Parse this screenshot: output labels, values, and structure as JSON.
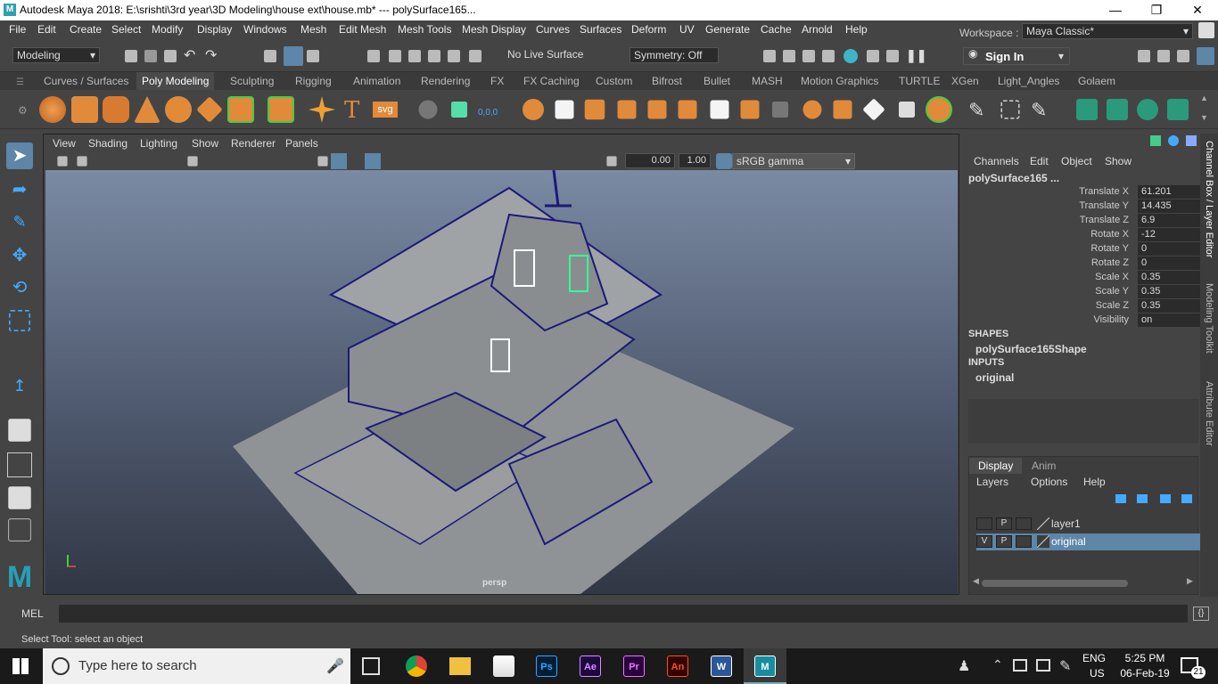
{
  "title": "Autodesk Maya 2018: E:\\srishti\\3rd year\\3D Modeling\\house ext\\house.mb*   ---   polySurface165...",
  "app_logo": "M",
  "menu": [
    "File",
    "Edit",
    "Create",
    "Select",
    "Modify",
    "Display",
    "Windows",
    "Mesh",
    "Edit Mesh",
    "Mesh Tools",
    "Mesh Display",
    "Curves",
    "Surfaces",
    "Deform",
    "UV",
    "Generate",
    "Cache",
    "Arnold",
    "Help"
  ],
  "workspace": {
    "label": "Workspace :",
    "value": "Maya Classic*"
  },
  "statusline": {
    "mode": "Modeling",
    "live": "No Live Surface",
    "symmetry": "Symmetry: Off",
    "sign_in": "Sign In"
  },
  "shelf_tabs": [
    "Curves / Surfaces",
    "Poly Modeling",
    "Sculpting",
    "Rigging",
    "Animation",
    "Rendering",
    "FX",
    "FX Caching",
    "Custom",
    "Bifrost",
    "Bullet",
    "MASH",
    "Motion Graphics",
    "TURTLE",
    "XGen",
    "Light_Angles",
    "Golaem"
  ],
  "shelf_text": {
    "text": "T",
    "svg": "svg",
    "coords": "0,0,0"
  },
  "viewport": {
    "menu": [
      "View",
      "Shading",
      "Lighting",
      "Show",
      "Renderer",
      "Panels"
    ],
    "field1": "0.00",
    "field2": "1.00",
    "colorspace": "sRGB gamma",
    "camera": "persp"
  },
  "channelbox": {
    "menu": [
      "Channels",
      "Edit",
      "Object",
      "Show"
    ],
    "object": "polySurface165 ...",
    "attrs": [
      {
        "label": "Translate X",
        "value": "61.201"
      },
      {
        "label": "Translate Y",
        "value": "14.435"
      },
      {
        "label": "Translate Z",
        "value": "6.9"
      },
      {
        "label": "Rotate X",
        "value": "-12"
      },
      {
        "label": "Rotate Y",
        "value": "0"
      },
      {
        "label": "Rotate Z",
        "value": "0"
      },
      {
        "label": "Scale X",
        "value": "0.35"
      },
      {
        "label": "Scale Y",
        "value": "0.35"
      },
      {
        "label": "Scale Z",
        "value": "0.35"
      },
      {
        "label": "Visibility",
        "value": "on"
      }
    ],
    "shapes_h": "SHAPES",
    "shape": "polySurface165Shape",
    "inputs_h": "INPUTS",
    "input": "original"
  },
  "layers": {
    "tabs": [
      "Display",
      "Anim"
    ],
    "menu": [
      "Layers",
      "Options",
      "Help"
    ],
    "rows": [
      {
        "v": "",
        "p": "P",
        "name": "layer1"
      },
      {
        "v": "V",
        "p": "P",
        "name": "original"
      }
    ]
  },
  "side_tabs": [
    "Channel Box / Layer Editor",
    "Modeling Toolkit",
    "Attribute Editor"
  ],
  "mel_label": "MEL",
  "help": "Select Tool: select an object",
  "taskbar": {
    "search": "Type here to search",
    "lang1": "ENG",
    "lang2": "US",
    "time": "5:25 PM",
    "date": "06-Feb-19",
    "notif": "21",
    "apps": [
      {
        "label": "Ps",
        "color": "#31a8ff",
        "bg": "#001e36"
      },
      {
        "label": "Ae",
        "color": "#d291ff",
        "bg": "#1f0740"
      },
      {
        "label": "Pr",
        "color": "#ea77ff",
        "bg": "#2a003f"
      },
      {
        "label": "An",
        "color": "#ff4f1a",
        "bg": "#330000"
      },
      {
        "label": "W",
        "color": "#ffffff",
        "bg": "#2b579a"
      },
      {
        "label": "M",
        "color": "#ffffff",
        "bg": "#168ea0"
      }
    ]
  }
}
